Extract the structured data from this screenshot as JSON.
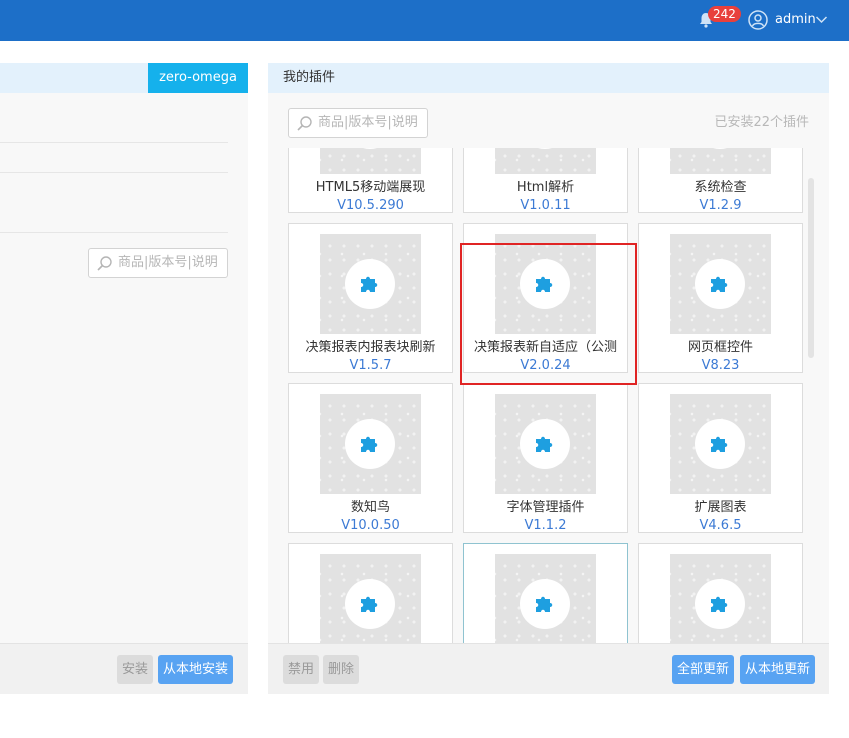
{
  "header": {
    "notification_count": "242",
    "username": "admin",
    "bell_icon": "bell-icon",
    "user_icon": "user-icon",
    "chevron_icon": "chevron-down-icon",
    "background_color": "#1d6fc8"
  },
  "left_panel": {
    "tag": "zero-omega",
    "search_placeholder": "商品|版本号|说明",
    "install_button": "安装",
    "local_install_button": "从本地安装"
  },
  "right_panel": {
    "title": "我的插件",
    "search_placeholder": "商品|版本号|说明",
    "installed_count": "已安装22个插件",
    "disable_button": "禁用",
    "delete_button": "删除",
    "update_all_button": "全部更新",
    "local_update_button": "从本地更新",
    "plugins": [
      {
        "name": "HTML5移动端展现",
        "version": "V10.5.290"
      },
      {
        "name": "Html解析",
        "version": "V1.0.11"
      },
      {
        "name": "系统检查",
        "version": "V1.2.9"
      },
      {
        "name": "决策报表内报表块刷新",
        "version": "V1.5.7"
      },
      {
        "name": "决策报表新自适应（公测",
        "version": "V2.0.24"
      },
      {
        "name": "网页框控件",
        "version": "V8.23"
      },
      {
        "name": "数知鸟",
        "version": "V10.0.50"
      },
      {
        "name": "字体管理插件",
        "version": "V1.1.2"
      },
      {
        "name": "扩展图表",
        "version": "V4.6.5"
      },
      {
        "name": "",
        "version": ""
      },
      {
        "name": "",
        "version": ""
      },
      {
        "name": "",
        "version": ""
      }
    ]
  },
  "colors": {
    "accent": "#15b1ec",
    "primary_button": "#58a3f2",
    "version_text": "#3c7ad4",
    "highlight_box": "#e02424",
    "badge": "#e8403c"
  }
}
